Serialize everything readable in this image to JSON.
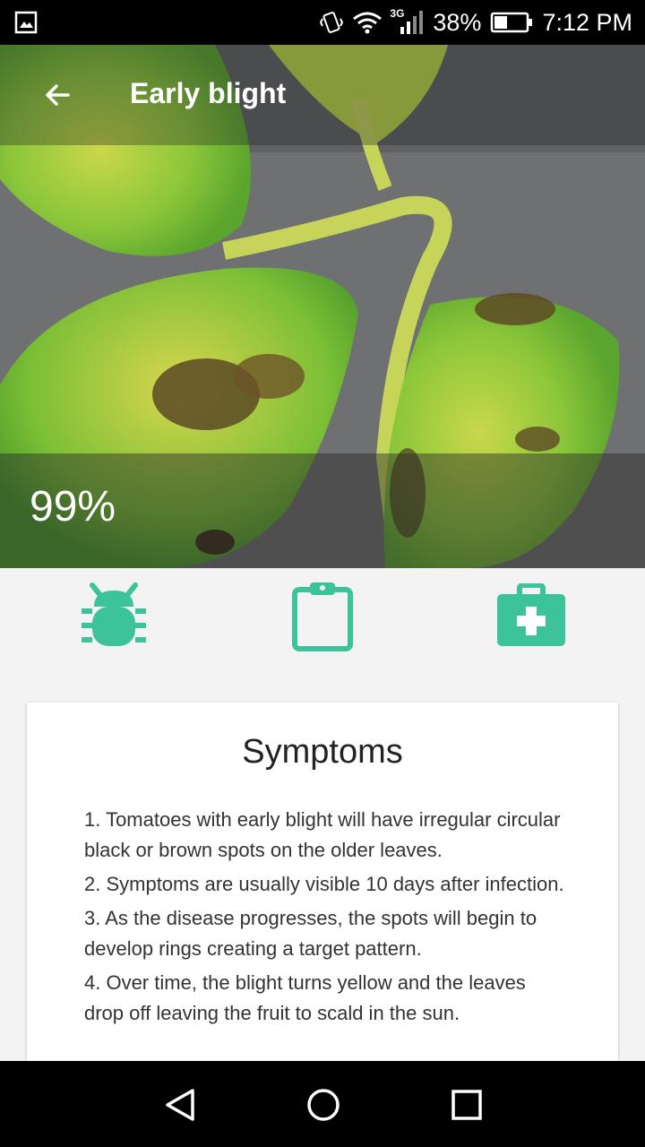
{
  "status_bar": {
    "battery": "38%",
    "time": "7:12 PM",
    "network": "3G",
    "icons": [
      "image-icon",
      "vibrate-icon",
      "wifi-icon",
      "signal-icon",
      "battery-icon"
    ]
  },
  "header": {
    "title": "Early blight",
    "back_icon": "arrow-left-icon"
  },
  "confidence": "99%",
  "actions": [
    {
      "icon": "bug-icon"
    },
    {
      "icon": "clipboard-icon"
    },
    {
      "icon": "medical-kit-icon"
    }
  ],
  "colors": {
    "accent": "#3cc39a",
    "background": "#f3f3f3"
  },
  "card": {
    "title": "Symptoms",
    "items": [
      "1. Tomatoes with early blight will have irregular circular black or brown spots on the older leaves.",
      "2. Symptoms are usually visible 10 days after infection.",
      "3. As the disease progresses, the spots will begin to develop rings creating a target pattern.",
      "4. Over time, the blight turns yellow and the leaves drop off leaving the fruit to scald in the sun."
    ]
  },
  "nav": {
    "icons": [
      "back-triangle-icon",
      "home-circle-icon",
      "recents-square-icon"
    ]
  }
}
